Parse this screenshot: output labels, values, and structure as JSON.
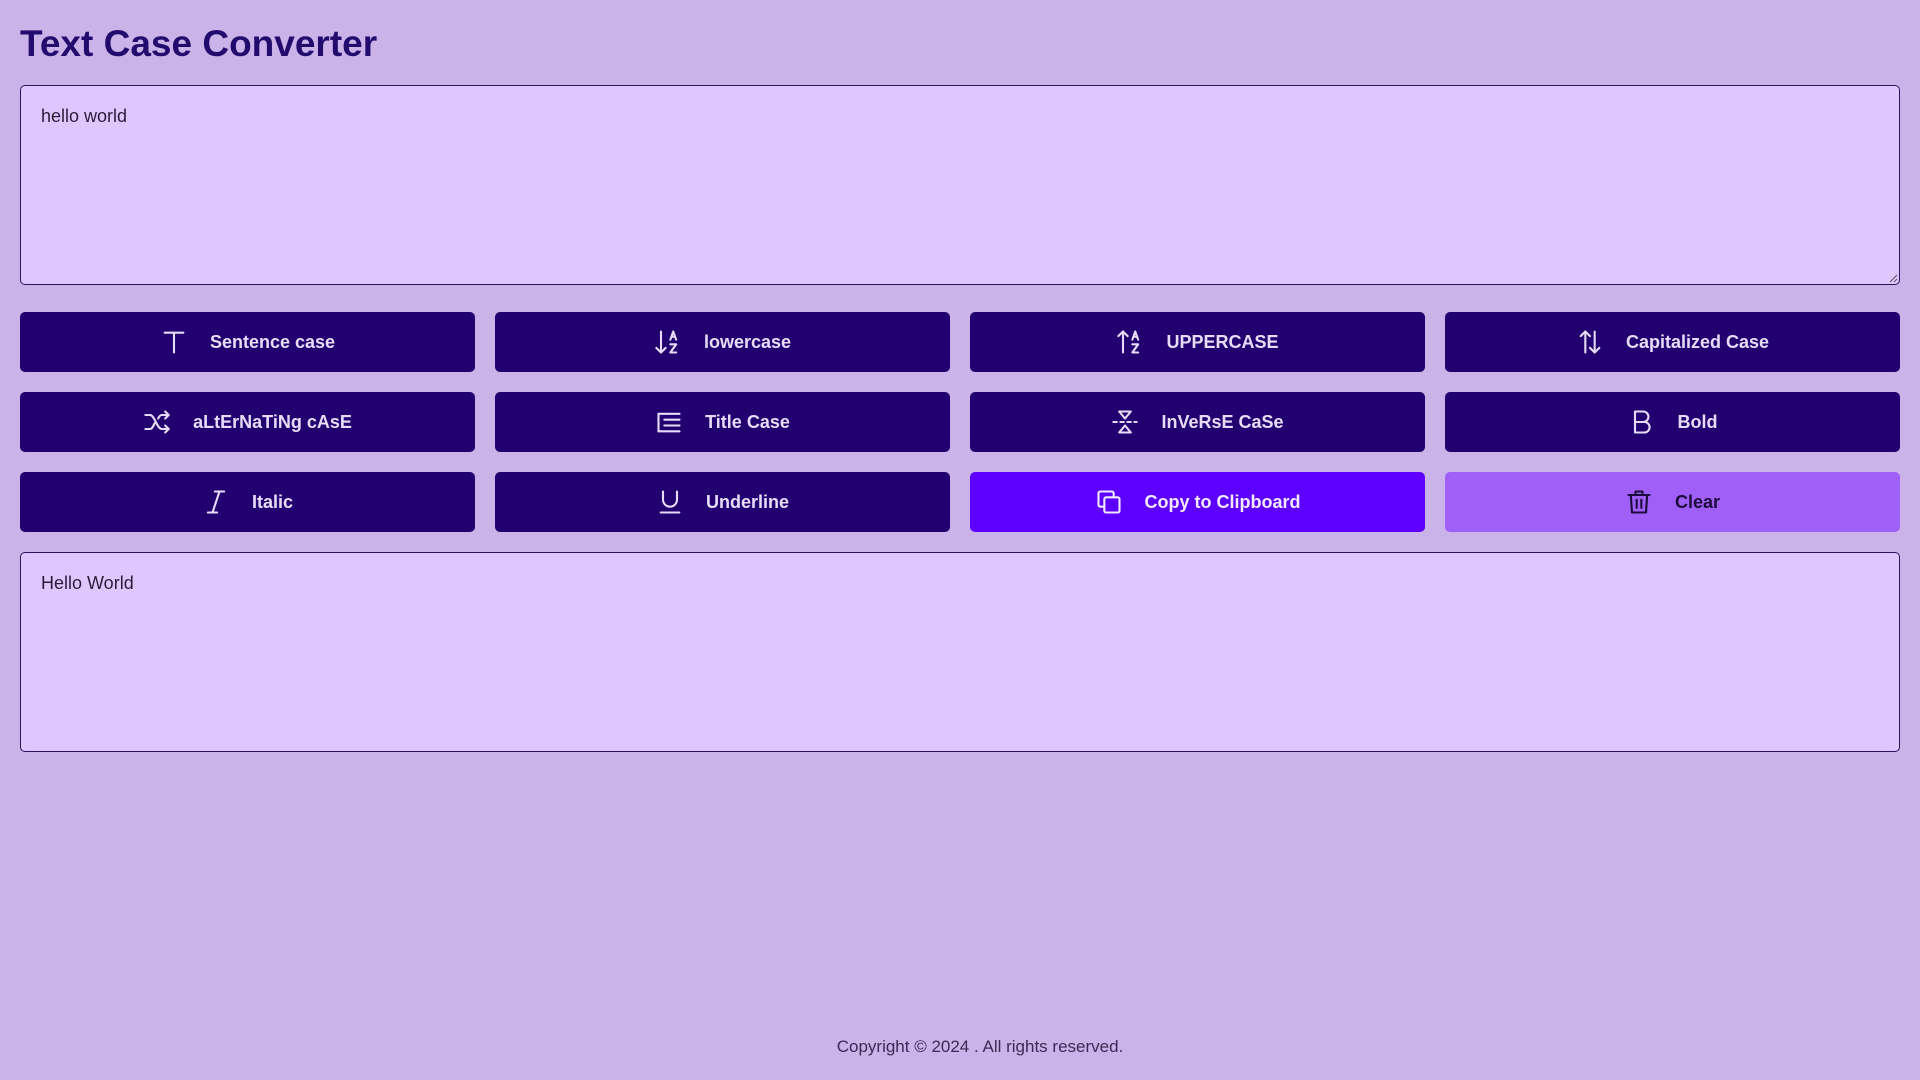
{
  "app": {
    "title": "Text Case Converter"
  },
  "input": {
    "value": "hello world"
  },
  "buttons": [
    {
      "label": "Sentence case",
      "icon": "text-t-icon"
    },
    {
      "label": "lowercase",
      "icon": "sort-descending-az-icon"
    },
    {
      "label": "UPPERCASE",
      "icon": "sort-ascending-az-icon"
    },
    {
      "label": "Capitalized Case",
      "icon": "arrows-up-down-icon"
    },
    {
      "label": "aLtErNaTiNg cAsE",
      "icon": "shuffle-icon"
    },
    {
      "label": "Title Case",
      "icon": "list-heading-icon"
    },
    {
      "label": "InVeRsE CaSe",
      "icon": "flip-vertical-icon"
    },
    {
      "label": "Bold",
      "icon": "bold-icon"
    },
    {
      "label": "Italic",
      "icon": "italic-icon"
    },
    {
      "label": "Underline",
      "icon": "underline-icon"
    },
    {
      "label": "Copy to Clipboard",
      "icon": "copy-icon"
    },
    {
      "label": "Clear",
      "icon": "trash-icon"
    }
  ],
  "output": {
    "value": "Hello World"
  },
  "footer": {
    "text": "Copyright © 2024 . All rights reserved."
  },
  "colors": {
    "background": "#cab3e8",
    "text_area": "#e0c6fe",
    "button": "#230070",
    "copy_button": "#5e00ff",
    "clear_button": "#a060f8",
    "title": "#230b6e"
  }
}
